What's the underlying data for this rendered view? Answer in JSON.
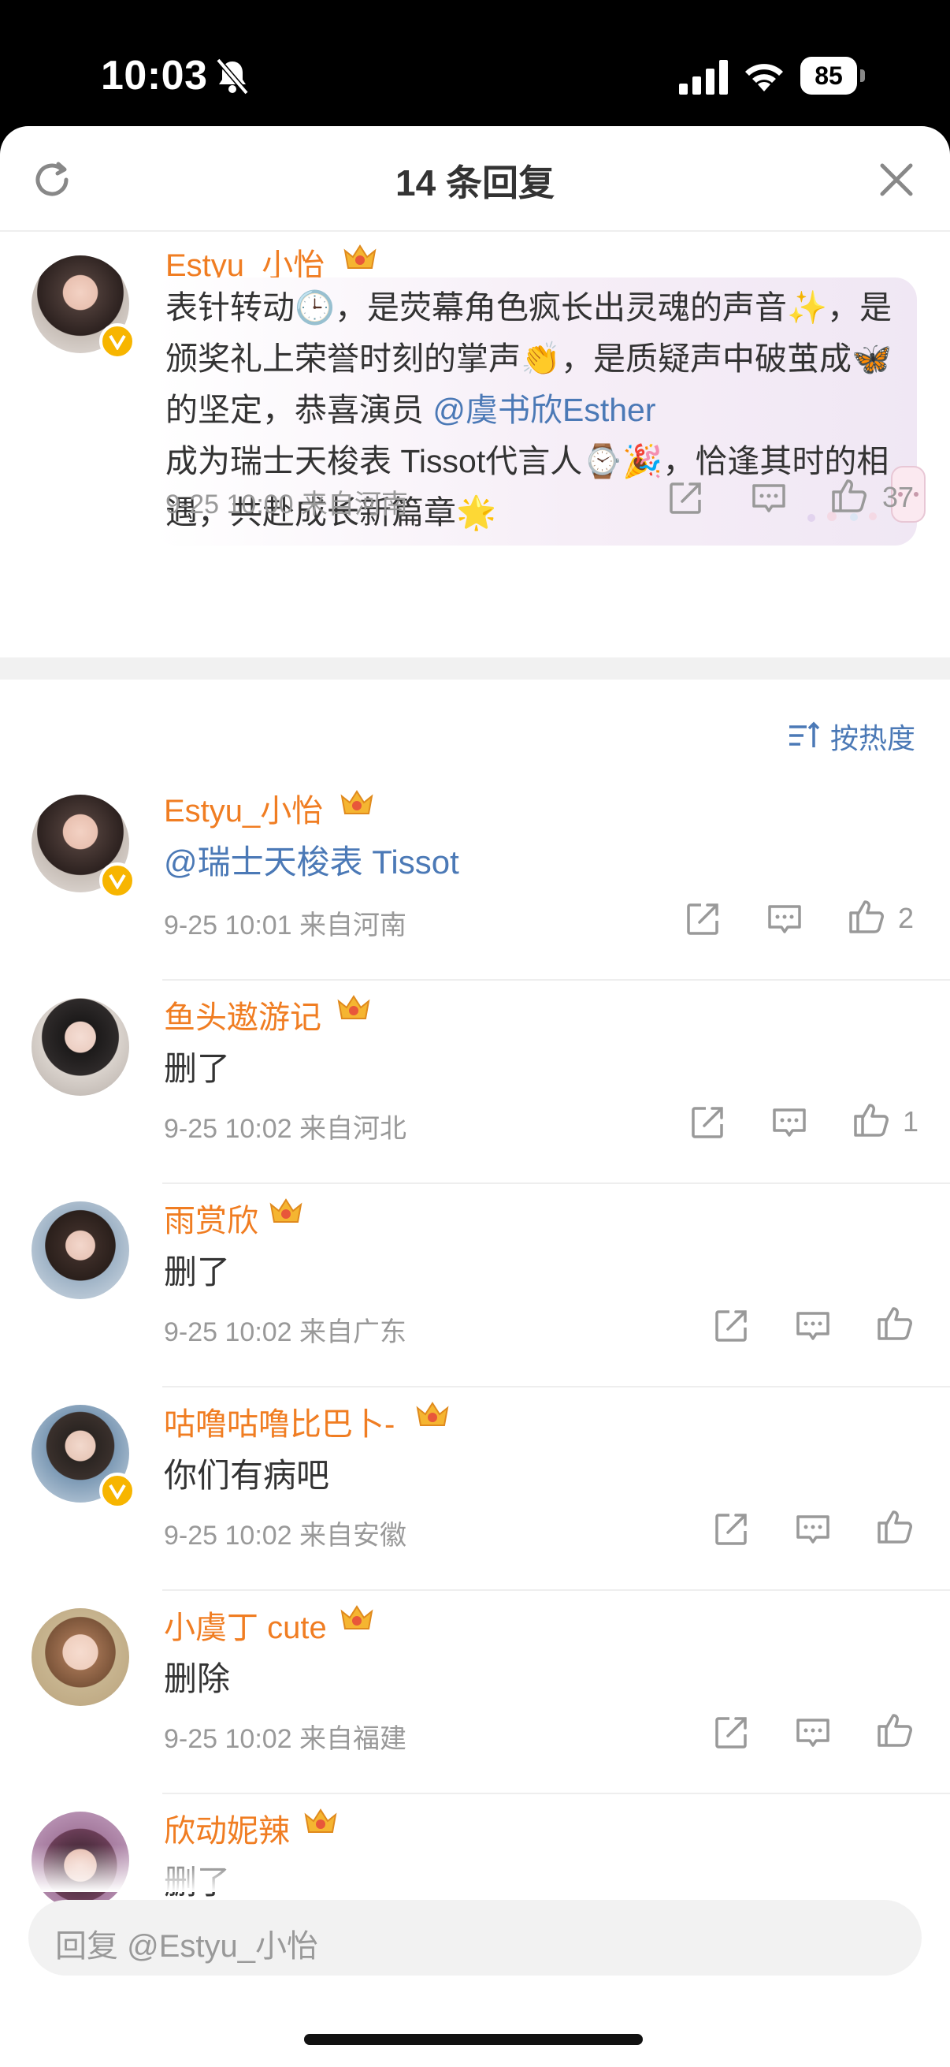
{
  "status_bar": {
    "time": "10:03",
    "battery": "85"
  },
  "header": {
    "title": "14 条回复"
  },
  "main_comment": {
    "author": "Estyu_小怡",
    "content_parts": {
      "p1": "表针转动",
      "p2": "，是荧幕角色疯长出灵魂的声音",
      "p3": "，是颁奖礼上荣誉时刻的掌声",
      "p4": "，是质疑声中破茧成",
      "p5": "的坚定，恭喜演员 ",
      "mention": "@虞书欣Esther",
      "p6": "成为瑞士天梭表 Tissot代言人",
      "p7": "，恰逢其时的相遇，共赴成长新篇章"
    },
    "meta": "9-25 10:00  来自河南",
    "likes": "37"
  },
  "sort_label": "按热度",
  "replies": [
    {
      "author": "Estyu_小怡",
      "text": "@瑞士天梭表 Tissot",
      "meta": "9-25 10:01  来自河南",
      "likes": "2"
    },
    {
      "author": "鱼头遨游记",
      "text": "删了",
      "meta": "9-25 10:02  来自河北",
      "likes": "1"
    },
    {
      "author": "雨赏欣",
      "text": "删了",
      "meta": "9-25 10:02  来自广东",
      "likes": ""
    },
    {
      "author": "咕噜咕噜比巴卜-",
      "text": "你们有病吧",
      "meta": "9-25 10:02  来自安徽",
      "likes": ""
    },
    {
      "author": "小虞丁 cute",
      "text": "删除",
      "meta": "9-25 10:02  来自福建",
      "likes": ""
    },
    {
      "author": "欣动妮辣",
      "text": "删了",
      "meta": "",
      "likes": ""
    }
  ],
  "reply_input": {
    "placeholder": "回复 @Estyu_小怡"
  },
  "colors": {
    "accent_orange": "#f07d22",
    "link_blue": "#4b79b6",
    "meta_gray": "#999999"
  }
}
